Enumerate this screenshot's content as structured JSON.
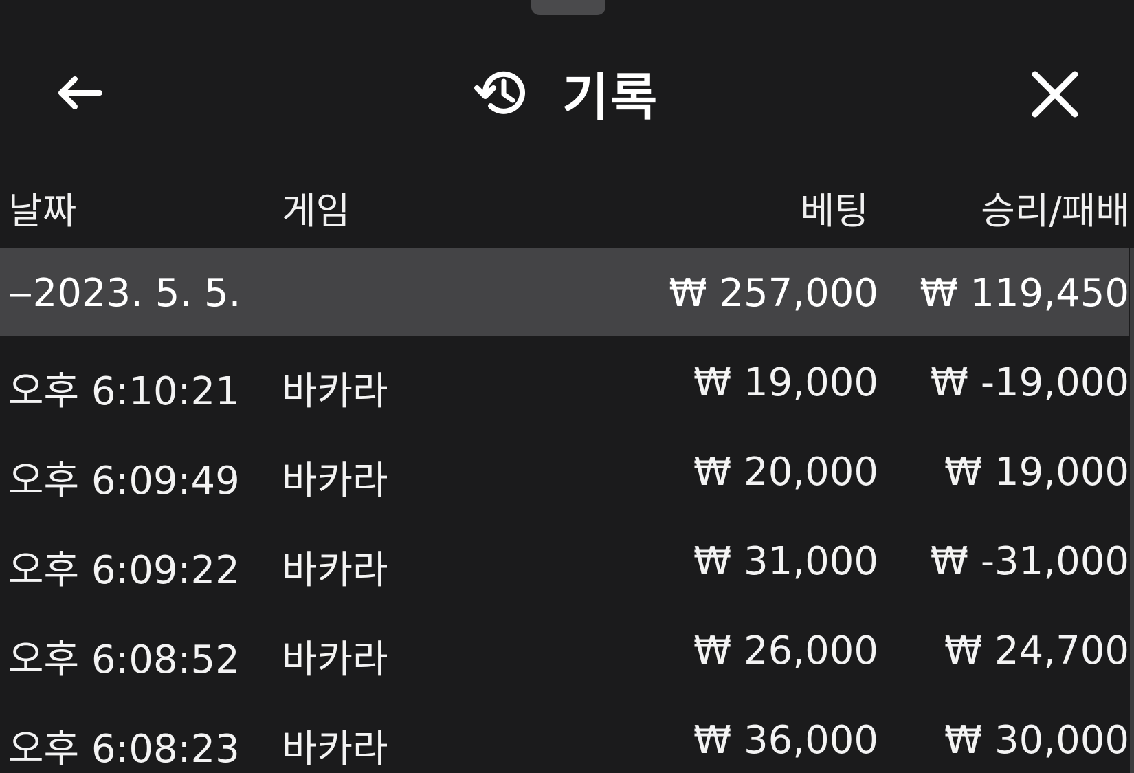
{
  "header": {
    "title": "기록",
    "back_icon": "arrow-left-icon",
    "history_icon": "history-clock-icon",
    "close_icon": "close-icon"
  },
  "columns": {
    "date": "날짜",
    "game": "게임",
    "bet": "베팅",
    "result": "승리/패배"
  },
  "date_group": {
    "label": "‒2023. 5. 5.",
    "bet_total": "₩ 257,000",
    "result_total": "₩ 119,450"
  },
  "rows": [
    {
      "time": "오후 6:10:21",
      "game": "바카라",
      "bet": "₩ 19,000",
      "result": "₩ -19,000"
    },
    {
      "time": "오후 6:09:49",
      "game": "바카라",
      "bet": "₩ 20,000",
      "result": "₩ 19,000"
    },
    {
      "time": "오후 6:09:22",
      "game": "바카라",
      "bet": "₩ 31,000",
      "result": "₩ -31,000"
    },
    {
      "time": "오후 6:08:52",
      "game": "바카라",
      "bet": "₩ 26,000",
      "result": "₩ 24,700"
    },
    {
      "time": "오후 6:08:23",
      "game": "바카라",
      "bet": "₩ 36,000",
      "result": "₩ 30,000"
    }
  ],
  "colors": {
    "background": "#1b1b1c",
    "group_row": "#444446",
    "text": "#f2f2f2"
  }
}
